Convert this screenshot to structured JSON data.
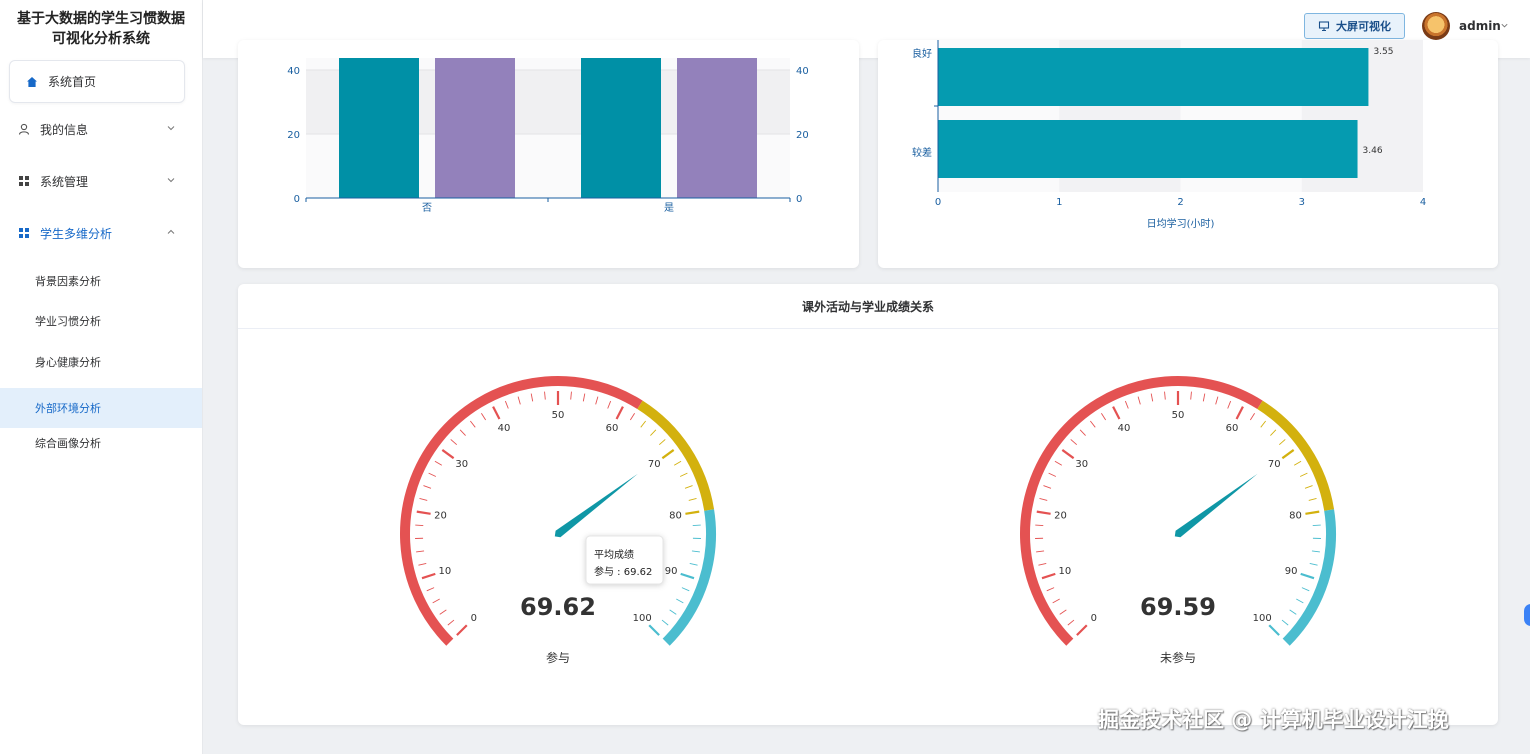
{
  "app": {
    "title_line1": "基于大数据的学生习惯数据",
    "title_line2": "可视化分析系统"
  },
  "sidebar": {
    "home": "系统首页",
    "items": [
      {
        "label": "我的信息"
      },
      {
        "label": "系统管理"
      },
      {
        "label": "学生多维分析"
      }
    ],
    "subitems": [
      {
        "label": "背景因素分析"
      },
      {
        "label": "学业习惯分析"
      },
      {
        "label": "身心健康分析"
      },
      {
        "label": "外部环境分析"
      },
      {
        "label": "综合画像分析"
      }
    ],
    "selected": "外部环境分析"
  },
  "header": {
    "bigscreen_label": "大屏可视化",
    "username": "admin"
  },
  "colors": {
    "teal": "#0090a6",
    "purple": "#9381bb",
    "hbar": "#059bb0",
    "gauge_red": "#e45252",
    "gauge_yellow": "#d3b10e",
    "gauge_cyan": "#4bbdcf",
    "pointer": "#0f97a6"
  },
  "chart_data": [
    {
      "type": "bar",
      "categories": [
        "否",
        "是"
      ],
      "series": [
        {
          "values": [
            null,
            null
          ]
        },
        {
          "values": [
            null,
            null
          ]
        }
      ],
      "yticks": [
        "0",
        "20",
        "40"
      ],
      "ylim": [
        0,
        60
      ],
      "grid": true
    },
    {
      "type": "bar",
      "orientation": "horizontal",
      "categories": [
        "良好",
        "较差"
      ],
      "values": [
        3.55,
        3.46
      ],
      "value_labels": [
        "3.55",
        "3.46"
      ],
      "xlabel": "日均学习(小时)",
      "xticks": [
        "0",
        "1",
        "2",
        "3",
        "4"
      ],
      "xlim": [
        0,
        4
      ]
    },
    {
      "type": "gauge",
      "title": "课外活动与学业成绩关系",
      "min": 0,
      "max": 100,
      "ticks": [
        "0",
        "10",
        "20",
        "30",
        "40",
        "50",
        "60",
        "70",
        "80",
        "90",
        "100"
      ],
      "gauges": [
        {
          "name": "参与",
          "value": 69.62,
          "display": "69.62"
        },
        {
          "name": "未参与",
          "value": 69.59,
          "display": "69.59"
        }
      ],
      "tooltip": {
        "title": "平均成绩",
        "text": "参与 : 69.62"
      }
    }
  ],
  "watermark": "掘金技术社区 @ 计算机毕业设计江挽"
}
